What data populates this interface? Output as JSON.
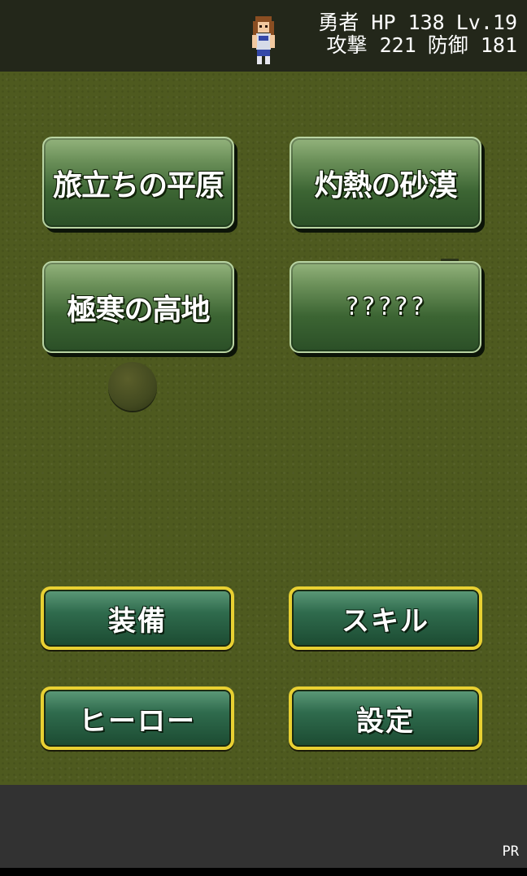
{
  "status": {
    "hero_name": "勇者",
    "hp_label": "HP",
    "hp_value": "138",
    "level_label": "Lv.",
    "level_value": "19",
    "attack_label": "攻撃",
    "attack_value": "221",
    "defense_label": "防御",
    "defense_value": "181"
  },
  "areas": [
    {
      "label": "旅立ちの平原"
    },
    {
      "label": "灼熱の砂漠"
    },
    {
      "label": "極寒の高地"
    },
    {
      "label": "?????"
    }
  ],
  "menu": {
    "equipment": "装備",
    "skill": "スキル",
    "hero": "ヒーロー",
    "settings": "設定"
  },
  "ad": {
    "pr_label": "PR"
  },
  "colors": {
    "field": "#4e5a1f",
    "status_bar": "#23271a",
    "area_button": "#3c6533",
    "menu_border": "#e8d032",
    "menu_button": "#2f6b4d",
    "ad_bar": "#323232"
  },
  "icons": {
    "hero": "hero-sprite-icon"
  }
}
